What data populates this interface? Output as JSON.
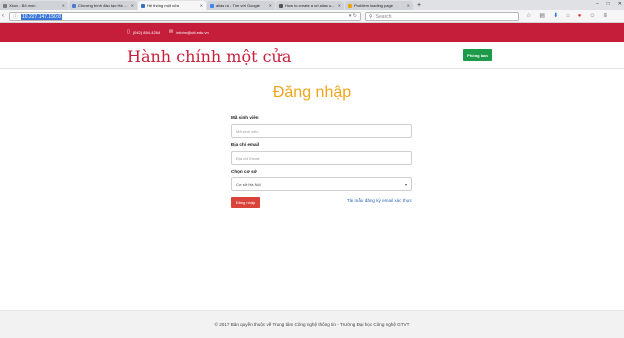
{
  "browser": {
    "tabs": [
      {
        "title": "Xbox - Bỏ mùn",
        "favicon_color": "#7a7a7a",
        "active": false
      },
      {
        "title": "Chương trình đào tạo Hà N...",
        "favicon_color": "#4a7bd0",
        "active": false
      },
      {
        "title": "Hệ thống một cửa",
        "favicon_color": "#3b6fc4",
        "active": true
      },
      {
        "title": "alias ra - Tìm với Google",
        "favicon_color": "#4285f4",
        "active": false
      },
      {
        "title": "How to create a url alias u...",
        "favicon_color": "#555555",
        "active": false
      },
      {
        "title": "Problem loading page",
        "favicon_color": "#e9a317",
        "active": false
      }
    ],
    "new_tab": "+",
    "url": "10.227.147.150:8",
    "search_placeholder": "Search",
    "window_controls": [
      "–",
      "□",
      "✕"
    ]
  },
  "topbar": {
    "phone": "(042) 854-4264",
    "email": "infohn@utt.edu.vn",
    "color": "#c41e3a"
  },
  "header": {
    "brand": "Hành chính một cửa",
    "room_button": "Phòng ban",
    "brand_color": "#c8203a"
  },
  "login": {
    "title": "Đăng nhập",
    "student_id_label": "Mã sinh viên",
    "student_id_placeholder": "Mã sinh viên",
    "email_label": "Địa chỉ email",
    "email_placeholder": "Địa chỉ Email",
    "campus_label": "Chọn cơ sở",
    "campus_value": "Cơ sở Hà Nội",
    "submit": "Đăng nhập",
    "register_link": "Tải mẫu đăng ký email xác thực"
  },
  "footer": {
    "text": "© 2017 Bản quyền thuộc về Trung tâm Công nghệ thông tin - Trường Đại học Công nghệ GTVT"
  }
}
